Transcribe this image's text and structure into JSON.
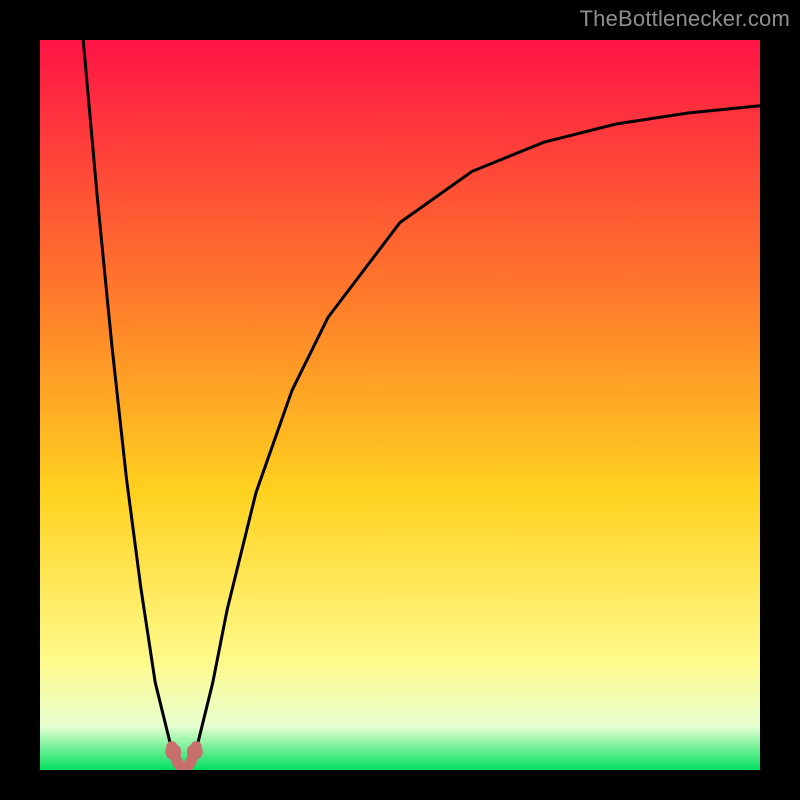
{
  "attribution": "TheBottlenecker.com",
  "colors": {
    "bg": "#000000",
    "gradient_top": "#ff1446",
    "gradient_mid1": "#ff7a2a",
    "gradient_mid2": "#ffd21f",
    "gradient_low": "#fffa8a",
    "gradient_pale": "#e6ffcf",
    "gradient_green": "#00e060",
    "curve": "#000000",
    "marker": "#c76f6a"
  },
  "chart_data": {
    "type": "line",
    "title": "",
    "xlabel": "",
    "ylabel": "",
    "xlim": [
      0,
      100
    ],
    "ylim": [
      0,
      100
    ],
    "series": [
      {
        "name": "bottleneck-curve",
        "x": [
          6,
          8,
          10,
          12,
          14,
          16,
          18,
          19,
          20,
          21,
          22,
          24,
          26,
          30,
          35,
          40,
          50,
          60,
          70,
          80,
          90,
          100
        ],
        "values": [
          100,
          78,
          58,
          40,
          25,
          12,
          4,
          1,
          0,
          1,
          4,
          12,
          22,
          38,
          52,
          62,
          75,
          82,
          86,
          88.5,
          90,
          91
        ]
      }
    ],
    "markers": [
      {
        "name": "left-foot",
        "x": 18.5,
        "y": 2.5
      },
      {
        "name": "right-foot",
        "x": 21.5,
        "y": 2.5
      }
    ]
  }
}
